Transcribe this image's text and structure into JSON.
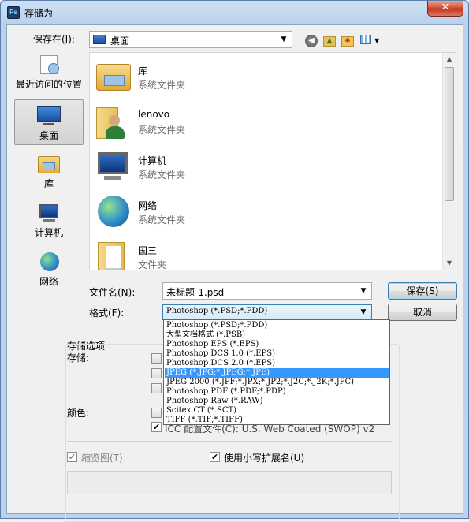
{
  "window": {
    "title": "存储为",
    "app_icon": "Ps"
  },
  "save_in": {
    "label": "保存在(I):",
    "value": "桌面"
  },
  "toolbar": {
    "back": "back-icon",
    "up": "up-folder-icon",
    "new_folder": "new-folder-icon",
    "views": "view-menu-icon"
  },
  "places": [
    {
      "label": "最近访问的位置",
      "icon": "recent-places-icon"
    },
    {
      "label": "桌面",
      "icon": "desktop-icon"
    },
    {
      "label": "库",
      "icon": "libraries-icon"
    },
    {
      "label": "计算机",
      "icon": "computer-icon"
    },
    {
      "label": "网络",
      "icon": "network-icon"
    }
  ],
  "files": [
    {
      "name": "库",
      "type": "系统文件夹",
      "icon": "libraries-icon"
    },
    {
      "name": "lenovo",
      "type": "系统文件夹",
      "icon": "user-folder-icon"
    },
    {
      "name": "计算机",
      "type": "系统文件夹",
      "icon": "computer-icon"
    },
    {
      "name": "网络",
      "type": "系统文件夹",
      "icon": "network-icon"
    },
    {
      "name": "国三",
      "type": "文件夹",
      "icon": "folder-icon"
    }
  ],
  "filename": {
    "label": "文件名(N):",
    "value": "未标题-1.psd"
  },
  "format": {
    "label": "格式(F):",
    "value": "Photoshop (*.PSD;*.PDD)"
  },
  "buttons": {
    "save": "保存(S)",
    "cancel": "取消"
  },
  "format_options": [
    "Photoshop (*.PSD;*.PDD)",
    "大型文档格式 (*.PSB)",
    "Photoshop EPS (*.EPS)",
    "Photoshop DCS 1.0 (*.EPS)",
    "Photoshop DCS 2.0 (*.EPS)",
    "JPEG (*.JPG;*.JPEG;*.JPE)",
    "JPEG 2000 (*.JPF;*.JPX;*.JP2;*.J2C;*.J2K;*.JPC)",
    "Photoshop PDF (*.PDF;*.PDP)",
    "Photoshop Raw (*.RAW)",
    "Scitex CT (*.SCT)",
    "TIFF (*.TIF;*.TIFF)"
  ],
  "highlighted_option_index": 5,
  "options": {
    "group_label": "存储选项",
    "save_label": "存储:",
    "color_label": "颜色:",
    "icc_label": "ICC 配置文件(C):  U.S. Web Coated (SWOP) v2",
    "thumbnail_label": "缩览图(T)",
    "lowercase_label": "使用小写扩展名(U)"
  }
}
